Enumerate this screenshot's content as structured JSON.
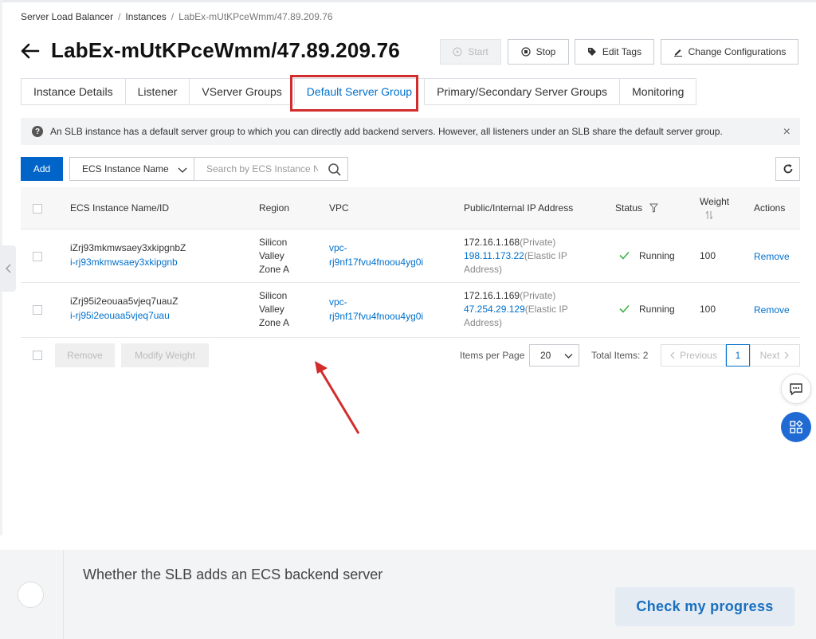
{
  "breadcrumb": {
    "items": [
      "Server Load Balancer",
      "Instances",
      "LabEx-mUtKPceWmm/47.89.209.76"
    ],
    "separator": "/"
  },
  "header": {
    "title": "LabEx-mUtKPceWmm/47.89.209.76",
    "buttons": {
      "start": "Start",
      "stop": "Stop",
      "edit_tags": "Edit Tags",
      "change_config": "Change Configurations"
    }
  },
  "tabs": [
    {
      "label": "Instance Details"
    },
    {
      "label": "Listener"
    },
    {
      "label": "VServer Groups"
    },
    {
      "label": "Default Server Group",
      "active": true
    },
    {
      "label": "Primary/Secondary Server Groups"
    },
    {
      "label": "Monitoring"
    }
  ],
  "notice": {
    "text": "An SLB instance has a default server group to which you can directly add backend servers. However, all listeners under an SLB share the default server group.",
    "close": "×"
  },
  "toolbar": {
    "add_label": "Add",
    "filter_selected": "ECS Instance Name",
    "search_placeholder": "Search by ECS Instance Name"
  },
  "table": {
    "columns": {
      "name": "ECS Instance Name/ID",
      "region": "Region",
      "vpc": "VPC",
      "ip": "Public/Internal IP Address",
      "status": "Status",
      "weight": "Weight",
      "actions": "Actions"
    },
    "rows": [
      {
        "name": "iZrj93mkmwsaey3xkipgnbZ",
        "id": "i-rj93mkmwsaey3xkipgnb",
        "region": [
          "Silicon",
          "Valley",
          "Zone A"
        ],
        "vpc": [
          "vpc-",
          "rj9nf17fvu4fnoou4yg0i"
        ],
        "private_ip": "172.16.1.168",
        "private_label": "(Private)",
        "public_ip": "198.11.173.22",
        "public_label": "(Elastic IP",
        "public_label2": "Address)",
        "status": "Running",
        "weight": "100",
        "action": "Remove"
      },
      {
        "name": "iZrj95i2eouaa5vjeq7uauZ",
        "id": "i-rj95i2eouaa5vjeq7uau",
        "region": [
          "Silicon",
          "Valley",
          "Zone A"
        ],
        "vpc": [
          "vpc-",
          "rj9nf17fvu4fnoou4yg0i"
        ],
        "private_ip": "172.16.1.169",
        "private_label": "(Private)",
        "public_ip": "47.254.29.129",
        "public_label": "(Elastic IP",
        "public_label2": "Address)",
        "status": "Running",
        "weight": "100",
        "action": "Remove"
      }
    ]
  },
  "footer": {
    "remove": "Remove",
    "modify_weight": "Modify Weight",
    "items_per_page_label": "Items per Page",
    "items_per_page": "20",
    "total_items": "Total Items: 2",
    "previous": "Previous",
    "current_page": "1",
    "next": "Next"
  },
  "task": {
    "question": "Whether the SLB adds an ECS backend server",
    "check_button": "Check my progress"
  },
  "colors": {
    "primary": "#0064c8",
    "link": "#0070cc",
    "highlight": "#d22d2d",
    "running": "#3bb346"
  }
}
